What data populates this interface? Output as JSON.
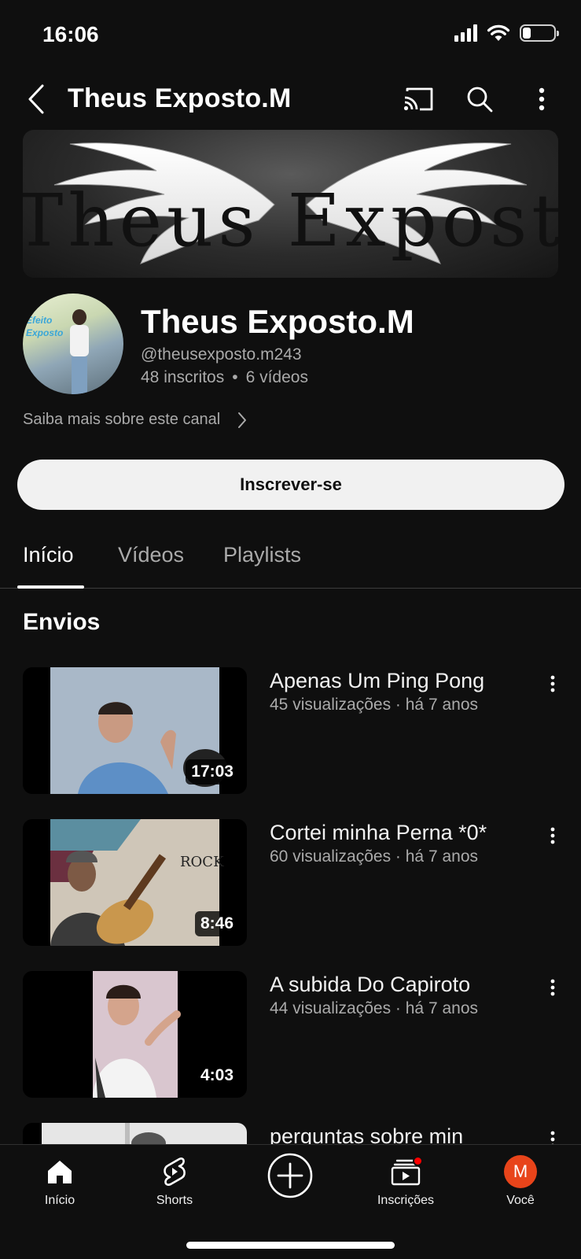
{
  "status_bar": {
    "time": "16:06",
    "battery_percent": 25
  },
  "header": {
    "title": "Theus Exposto.M"
  },
  "banner": {
    "text": "Theus Exposto.M"
  },
  "channel": {
    "avatar_text": "Efeito\nExposto",
    "name": "Theus Exposto.M",
    "handle": "@theusexposto.m243",
    "subscribers": "48 inscritos",
    "separator": "•",
    "videos_count": "6 vídeos",
    "about_label": "Saiba mais sobre este canal",
    "subscribe_label": "Inscrever-se"
  },
  "tabs": [
    {
      "label": "Início",
      "active": true
    },
    {
      "label": "Vídeos",
      "active": false
    },
    {
      "label": "Playlists",
      "active": false
    }
  ],
  "section": {
    "title": "Envios"
  },
  "videos": [
    {
      "title": "Apenas Um Ping Pong",
      "meta": "45 visualizações · há 7 anos",
      "duration": "17:03"
    },
    {
      "title": "Cortei minha Perna *0*",
      "meta": "60 visualizações · há 7 anos",
      "duration": "8:46"
    },
    {
      "title": "A subida Do Capiroto",
      "meta": "44 visualizações · há 7 anos",
      "duration": "4:03"
    },
    {
      "title": "perguntas sobre min",
      "meta": "",
      "duration": ""
    }
  ],
  "bottom_nav": {
    "home": "Início",
    "shorts": "Shorts",
    "subscriptions": "Inscrições",
    "you": "Você",
    "user_initial": "M"
  }
}
